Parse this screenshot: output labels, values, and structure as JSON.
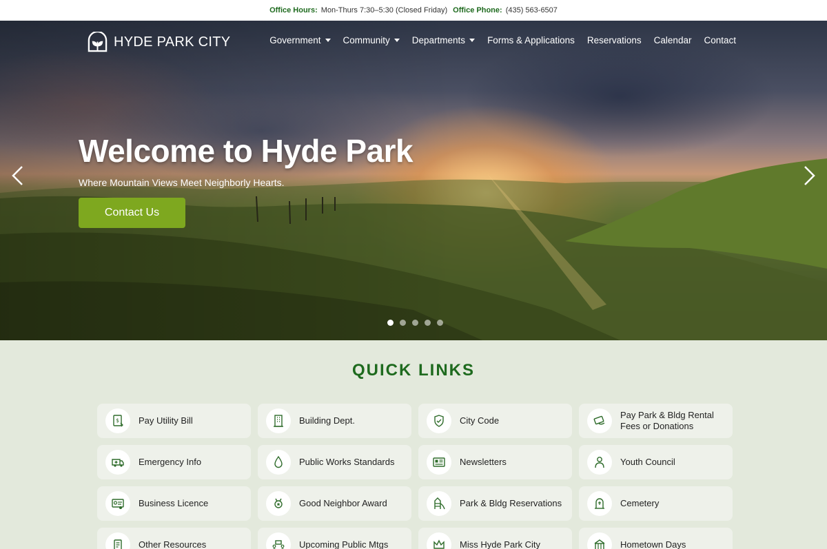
{
  "topbar": {
    "hours_label": "Office Hours:",
    "hours_value": "Mon-Thurs 7:30–5:30 (Closed Friday)",
    "phone_label": "Office Phone:",
    "phone_value": "(435) 563-6507"
  },
  "header": {
    "logo_text": "HYDE PARK CITY",
    "nav": [
      {
        "label": "Government",
        "dropdown": true
      },
      {
        "label": "Community",
        "dropdown": true
      },
      {
        "label": "Departments",
        "dropdown": true
      },
      {
        "label": "Forms & Applications",
        "dropdown": false
      },
      {
        "label": "Reservations",
        "dropdown": false
      },
      {
        "label": "Calendar",
        "dropdown": false
      },
      {
        "label": "Contact",
        "dropdown": false
      }
    ]
  },
  "hero": {
    "title": "Welcome to Hyde Park",
    "subtitle": "Where Mountain Views Meet Neighborly Hearts.",
    "cta_label": "Contact Us",
    "slide_count": 5,
    "active_slide": 1,
    "prev_icon": "chevron-left-icon",
    "next_icon": "chevron-right-icon"
  },
  "quick_links": {
    "title": "QUICK LINKS",
    "items": [
      {
        "label": "Pay Utility Bill",
        "icon": "bill-icon"
      },
      {
        "label": "Building Dept.",
        "icon": "building-icon"
      },
      {
        "label": "City Code",
        "icon": "shield-icon"
      },
      {
        "label": "Pay Park & Bldg Rental Fees or Donations",
        "icon": "payment-icon"
      },
      {
        "label": "Emergency Info",
        "icon": "ambulance-icon"
      },
      {
        "label": "Public Works Standards",
        "icon": "water-drop-icon"
      },
      {
        "label": "Newsletters",
        "icon": "newspaper-icon"
      },
      {
        "label": "Youth Council",
        "icon": "person-icon"
      },
      {
        "label": "Business Licence",
        "icon": "license-icon"
      },
      {
        "label": "Good Neighbor Award",
        "icon": "award-icon"
      },
      {
        "label": "Park & Bldg Reservations",
        "icon": "playground-icon"
      },
      {
        "label": "Cemetery",
        "icon": "headstone-icon"
      },
      {
        "label": "Other Resources",
        "icon": "document-icon"
      },
      {
        "label": "Upcoming Public Mtgs",
        "icon": "meeting-icon"
      },
      {
        "label": "Miss Hyde Park City",
        "icon": "crown-icon"
      },
      {
        "label": "Hometown Days",
        "icon": "carnival-icon"
      }
    ]
  },
  "colors": {
    "accent_green": "#1e6a1e",
    "cta_green": "#7ea81f",
    "section_bg": "#e3e9dc",
    "card_bg": "#eef1ea"
  }
}
